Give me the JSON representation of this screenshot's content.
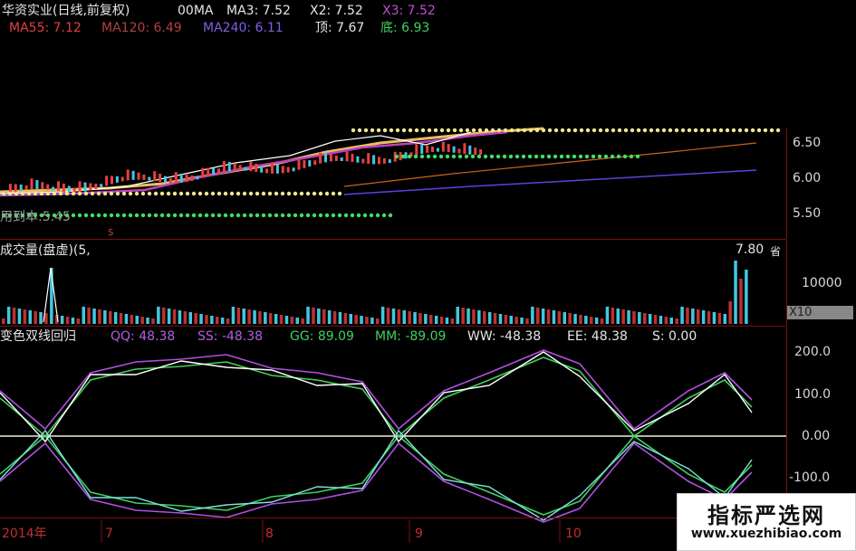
{
  "main_panel": {
    "title": "华资实业(日线,前复权)",
    "items": [
      {
        "label": "00MA",
        "color": "#e6e6e6"
      },
      {
        "label": "MA3: 7.52",
        "color": "#e6e6e6"
      },
      {
        "label": "X2: 7.52",
        "color": "#e6e6e6"
      },
      {
        "label": "X3: 7.52",
        "color": "#c050d0"
      }
    ],
    "items2": [
      {
        "label": "MA55: 7.12",
        "color": "#e04040"
      },
      {
        "label": "MA120: 6.49",
        "color": "#b04040"
      },
      {
        "label": "MA240: 6.11",
        "color": "#8060e0"
      },
      {
        "label": "顶: 7.67",
        "color": "#e6e6e6"
      },
      {
        "label": "底: 6.93",
        "color": "#40d060"
      }
    ],
    "note": "用到本:5.45",
    "marker": "S",
    "ticks": [
      "6.50",
      "6.00",
      "5.50"
    ]
  },
  "volume_panel": {
    "title": "成交量(盘虚)(5,",
    "peak_label": "7.80",
    "corner": "省",
    "ticks": [
      "10000"
    ],
    "unit": "X10"
  },
  "indicator_panel": {
    "title": "变色双线回归",
    "items": [
      {
        "label": "QQ: 48.38",
        "color": "#b060e0"
      },
      {
        "label": "SS: -48.38",
        "color": "#b060e0"
      },
      {
        "label": "GG: 89.09",
        "color": "#40d060"
      },
      {
        "label": "MM: -89.09",
        "color": "#40d060"
      },
      {
        "label": "WW: -48.38",
        "color": "#e6e6e6"
      },
      {
        "label": "EE: 48.38",
        "color": "#e6e6e6"
      },
      {
        "label": "S: 0.00",
        "color": "#e6e6e6"
      }
    ],
    "ticks": [
      "200.0",
      "100.0",
      "0.00",
      "-100.0"
    ]
  },
  "time_axis": {
    "labels": [
      "2014年",
      "7",
      "8",
      "9",
      "10"
    ]
  },
  "watermark": {
    "name": "指标严选网",
    "url": "www.xuezhibiao.com"
  }
}
